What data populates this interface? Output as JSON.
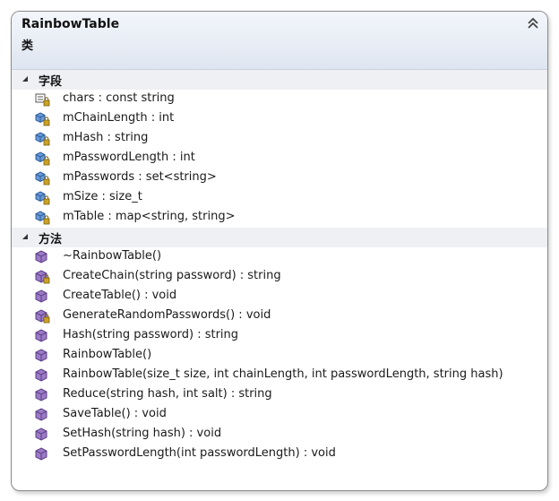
{
  "class": {
    "name": "RainbowTable",
    "kind": "类"
  },
  "sections": {
    "fields": {
      "title": "字段",
      "items": [
        {
          "text": "chars : const string",
          "icon": "constant-icon",
          "lock": true
        },
        {
          "text": "mChainLength : int",
          "icon": "field-icon",
          "lock": true
        },
        {
          "text": "mHash : string",
          "icon": "field-icon",
          "lock": true
        },
        {
          "text": "mPasswordLength : int",
          "icon": "field-icon",
          "lock": true
        },
        {
          "text": "mPasswords : set<string>",
          "icon": "field-icon",
          "lock": true
        },
        {
          "text": "mSize : size_t",
          "icon": "field-icon",
          "lock": true
        },
        {
          "text": "mTable : map<string, string>",
          "icon": "field-icon",
          "lock": true
        }
      ]
    },
    "methods": {
      "title": "方法",
      "items": [
        {
          "text": "~RainbowTable()",
          "icon": "method-icon",
          "lock": false
        },
        {
          "text": "CreateChain(string password) : string",
          "icon": "method-icon",
          "lock": true
        },
        {
          "text": "CreateTable() : void",
          "icon": "method-icon",
          "lock": false
        },
        {
          "text": "GenerateRandomPasswords() : void",
          "icon": "method-icon",
          "lock": true
        },
        {
          "text": "Hash(string password) : string",
          "icon": "method-icon",
          "lock": false
        },
        {
          "text": "RainbowTable()",
          "icon": "method-icon",
          "lock": false
        },
        {
          "text": "RainbowTable(size_t size, int chainLength, int passwordLength, string hash)",
          "icon": "method-icon",
          "lock": false
        },
        {
          "text": "Reduce(string hash, int salt) : string",
          "icon": "method-icon",
          "lock": false
        },
        {
          "text": "SaveTable() : void",
          "icon": "method-icon",
          "lock": false
        },
        {
          "text": "SetHash(string hash) : void",
          "icon": "method-icon",
          "lock": false
        },
        {
          "text": "SetPasswordLength(int passwordLength) : void",
          "icon": "method-icon",
          "lock": false
        }
      ]
    }
  },
  "colors": {
    "header_gradient_top": "#f3f6fb",
    "header_gradient_bottom": "#dfe6f1",
    "field_icon_fill": "#6a9bd8",
    "method_icon_fill": "#9b7cc4",
    "lock_color": "#c9a227"
  },
  "icons": {
    "collapse": "double-chevron-up-icon",
    "section_toggle": "expanded-triangle-icon"
  }
}
